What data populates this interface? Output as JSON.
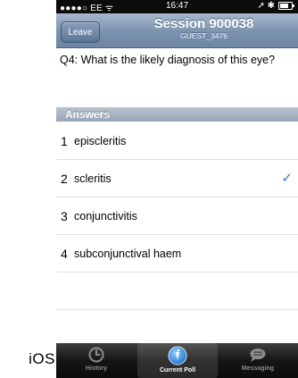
{
  "statusbar": {
    "carrier": "●●●●○ EE ᯤ",
    "time": "16:47",
    "icons": "➚ ✱"
  },
  "nav": {
    "leave_label": "Leave",
    "title": "Session 900038",
    "subtitle": "GUEST_3476"
  },
  "question": "Q4: What is the likely diagnosis of this eye?",
  "answers_header": "Answers",
  "answers": [
    {
      "num": "1",
      "text": "episcleritis",
      "selected": false
    },
    {
      "num": "2",
      "text": "scleritis",
      "selected": true
    },
    {
      "num": "3",
      "text": "conjunctivitis",
      "selected": false
    },
    {
      "num": "4",
      "text": "subconjunctival haem",
      "selected": false
    }
  ],
  "check_glyph": "✓",
  "platform_label": "iOS",
  "tabs": [
    {
      "label": "History",
      "icon": "clock-icon",
      "active": false
    },
    {
      "label": "Current Poll",
      "icon": "poll-icon",
      "active": true
    },
    {
      "label": "Messaging",
      "icon": "chat-bubble-icon",
      "active": false
    }
  ],
  "colors": {
    "nav_blue": "#7a92ae",
    "check_blue": "#3a73c9",
    "tabbar": "#161616"
  }
}
